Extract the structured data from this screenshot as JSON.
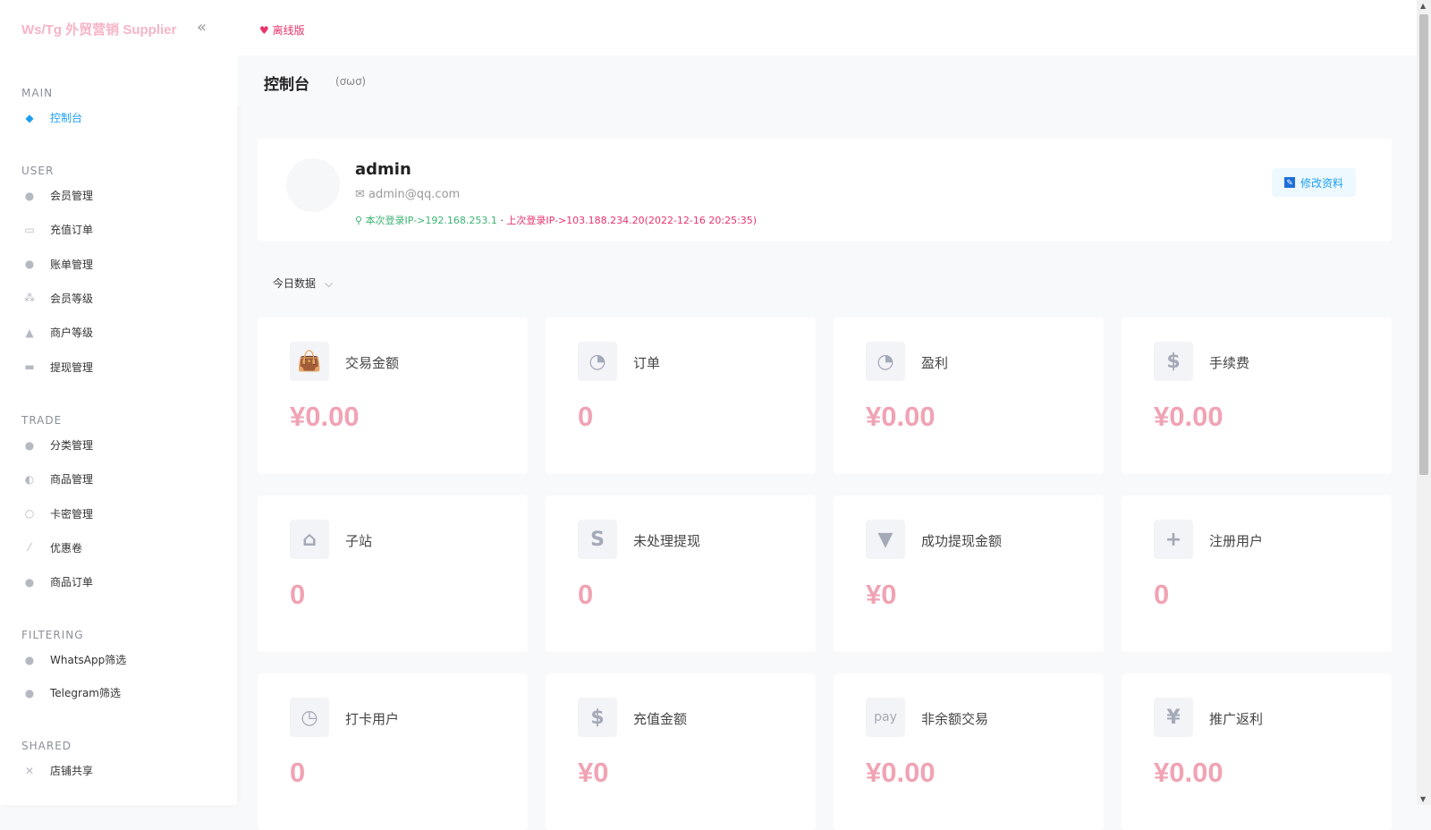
{
  "app": {
    "brand": "Ws/Tg 外贸营销 Supplier",
    "offline_label": "离线版"
  },
  "sidebar": {
    "sections": [
      {
        "title": "MAIN",
        "items": [
          {
            "label": "控制台",
            "icon": "dashboard-icon",
            "active": true
          }
        ]
      },
      {
        "title": "USER",
        "items": [
          {
            "label": "会员管理",
            "icon": "user-icon"
          },
          {
            "label": "充值订单",
            "icon": "recharge-icon"
          },
          {
            "label": "账单管理",
            "icon": "bill-icon"
          },
          {
            "label": "会员等级",
            "icon": "level-icon"
          },
          {
            "label": "商户等级",
            "icon": "merchant-icon"
          },
          {
            "label": "提现管理",
            "icon": "withdraw-icon"
          }
        ]
      },
      {
        "title": "TRADE",
        "items": [
          {
            "label": "分类管理",
            "icon": "category-icon"
          },
          {
            "label": "商品管理",
            "icon": "goods-icon"
          },
          {
            "label": "卡密管理",
            "icon": "card-key-icon"
          },
          {
            "label": "优惠卷",
            "icon": "coupon-icon"
          },
          {
            "label": "商品订单",
            "icon": "order-icon"
          }
        ]
      },
      {
        "title": "FILTERING",
        "items": [
          {
            "label": "WhatsApp筛选",
            "icon": "whatsapp-icon"
          },
          {
            "label": "Telegram筛选",
            "icon": "telegram-icon"
          }
        ]
      },
      {
        "title": "SHARED",
        "items": [
          {
            "label": "店铺共享",
            "icon": "share-icon"
          }
        ]
      }
    ]
  },
  "page": {
    "title": "控制台",
    "face": "(ơωơ)"
  },
  "profile": {
    "name": "admin",
    "email": "admin@qq.com",
    "current_ip": "本次登录IP->192.168.253.1",
    "last_ip": "上次登录IP->103.188.234.20(2022-12-16 20:25:35)",
    "edit_label": "修改资料"
  },
  "range": {
    "selected": "今日数据"
  },
  "stats": [
    {
      "label": "交易金额",
      "value": "¥0.00",
      "icon": "bag-icon",
      "glyph": "👜"
    },
    {
      "label": "订单",
      "value": "0",
      "icon": "pie-chart-icon",
      "glyph": "◔"
    },
    {
      "label": "盈利",
      "value": "¥0.00",
      "icon": "pie-chart-icon",
      "glyph": "◔"
    },
    {
      "label": "手续费",
      "value": "¥0.00",
      "icon": "fee-icon",
      "glyph": "$"
    },
    {
      "label": "子站",
      "value": "0",
      "icon": "house-icon",
      "glyph": "⌂"
    },
    {
      "label": "未处理提现",
      "value": "0",
      "icon": "dollar-icon",
      "glyph": "S"
    },
    {
      "label": "成功提现金额",
      "value": "¥0",
      "icon": "funnel-icon",
      "glyph": "▼"
    },
    {
      "label": "注册用户",
      "value": "0",
      "icon": "user-plus-icon",
      "glyph": "+"
    },
    {
      "label": "打卡用户",
      "value": "0",
      "icon": "clock-icon",
      "glyph": "◷"
    },
    {
      "label": "充值金额",
      "value": "¥0",
      "icon": "hand-money-icon",
      "glyph": "$"
    },
    {
      "label": "非余额交易",
      "value": "¥0.00",
      "icon": "pay-icon",
      "glyph": "pay"
    },
    {
      "label": "推广返利",
      "value": "¥0.00",
      "icon": "yen-icon",
      "glyph": "¥"
    }
  ],
  "colors": {
    "accent": "#1e9ff2",
    "value": "#f0a3b4",
    "brand": "#f7b4c6"
  }
}
